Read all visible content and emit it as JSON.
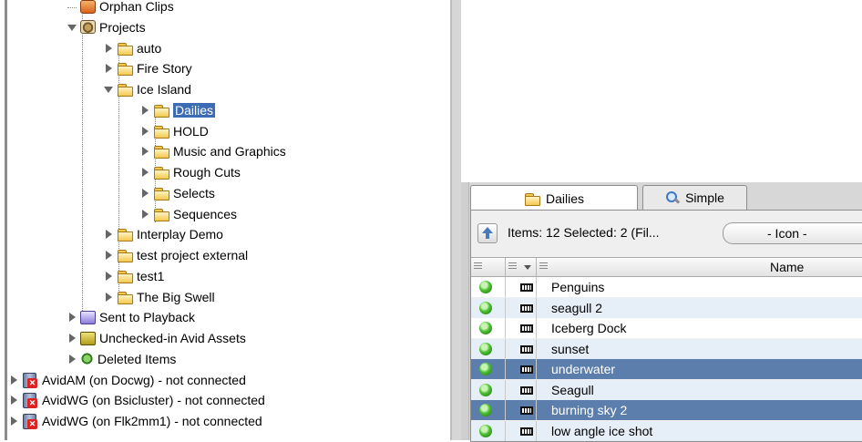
{
  "tree": {
    "items": [
      {
        "label": "Orphan Clips",
        "icon": "orphan-clips-icon",
        "expanded": null
      },
      {
        "label": "Projects",
        "icon": "projects-icon",
        "expanded": true
      },
      {
        "label": "auto",
        "icon": "folder-icon",
        "expanded": false
      },
      {
        "label": "Fire Story",
        "icon": "folder-icon",
        "expanded": false
      },
      {
        "label": "Ice Island",
        "icon": "folder-icon",
        "expanded": true
      },
      {
        "label": "Dailies",
        "icon": "folder-icon",
        "expanded": false,
        "selected": true
      },
      {
        "label": "HOLD",
        "icon": "folder-icon",
        "expanded": false
      },
      {
        "label": "Music and Graphics",
        "icon": "folder-icon",
        "expanded": false
      },
      {
        "label": "Rough Cuts",
        "icon": "folder-icon",
        "expanded": false
      },
      {
        "label": "Selects",
        "icon": "folder-icon",
        "expanded": false
      },
      {
        "label": "Sequences",
        "icon": "folder-icon",
        "expanded": false
      },
      {
        "label": "Interplay Demo",
        "icon": "folder-icon",
        "expanded": false
      },
      {
        "label": "test project external",
        "icon": "folder-icon",
        "expanded": false
      },
      {
        "label": "test1",
        "icon": "folder-icon",
        "expanded": false
      },
      {
        "label": "The Big Swell",
        "icon": "folder-icon",
        "expanded": false
      },
      {
        "label": "Sent to Playback",
        "icon": "playback-icon",
        "expanded": false
      },
      {
        "label": "Unchecked-in Avid Assets",
        "icon": "unchecked-assets-icon",
        "expanded": false
      },
      {
        "label": "Deleted Items",
        "icon": "deleted-items-icon",
        "expanded": false
      },
      {
        "label": "AvidAM (on Docwg)  - not connected",
        "icon": "database-disconnected-icon",
        "expanded": false
      },
      {
        "label": "AvidWG (on Bsicluster)  - not connected",
        "icon": "database-disconnected-icon",
        "expanded": false
      },
      {
        "label": "AvidWG (on Flk2mm1)  - not connected",
        "icon": "database-disconnected-icon",
        "expanded": false
      }
    ]
  },
  "bin": {
    "tabs": [
      {
        "label": "Dailies",
        "icon": "folder-icon",
        "active": true
      },
      {
        "label": "Simple",
        "icon": "search-icon",
        "active": false
      }
    ],
    "items_text": "Items: 12 Selected: 2 (Fil...",
    "view_select": "- Icon -",
    "columns": {
      "name": "Name"
    },
    "rows": [
      {
        "name": "Penguins",
        "selected": false
      },
      {
        "name": "seagull 2",
        "selected": false
      },
      {
        "name": "Iceberg Dock",
        "selected": false
      },
      {
        "name": "sunset",
        "selected": false
      },
      {
        "name": "underwater",
        "selected": true
      },
      {
        "name": "Seagull",
        "selected": false
      },
      {
        "name": "burning sky 2",
        "selected": true
      },
      {
        "name": "low angle ice shot",
        "selected": false
      }
    ]
  },
  "colors": {
    "selection": "#3c6cb3",
    "row_selected": "#5b7eac",
    "row_alt": "#e6eef8",
    "status_online": "#4fbf34"
  }
}
